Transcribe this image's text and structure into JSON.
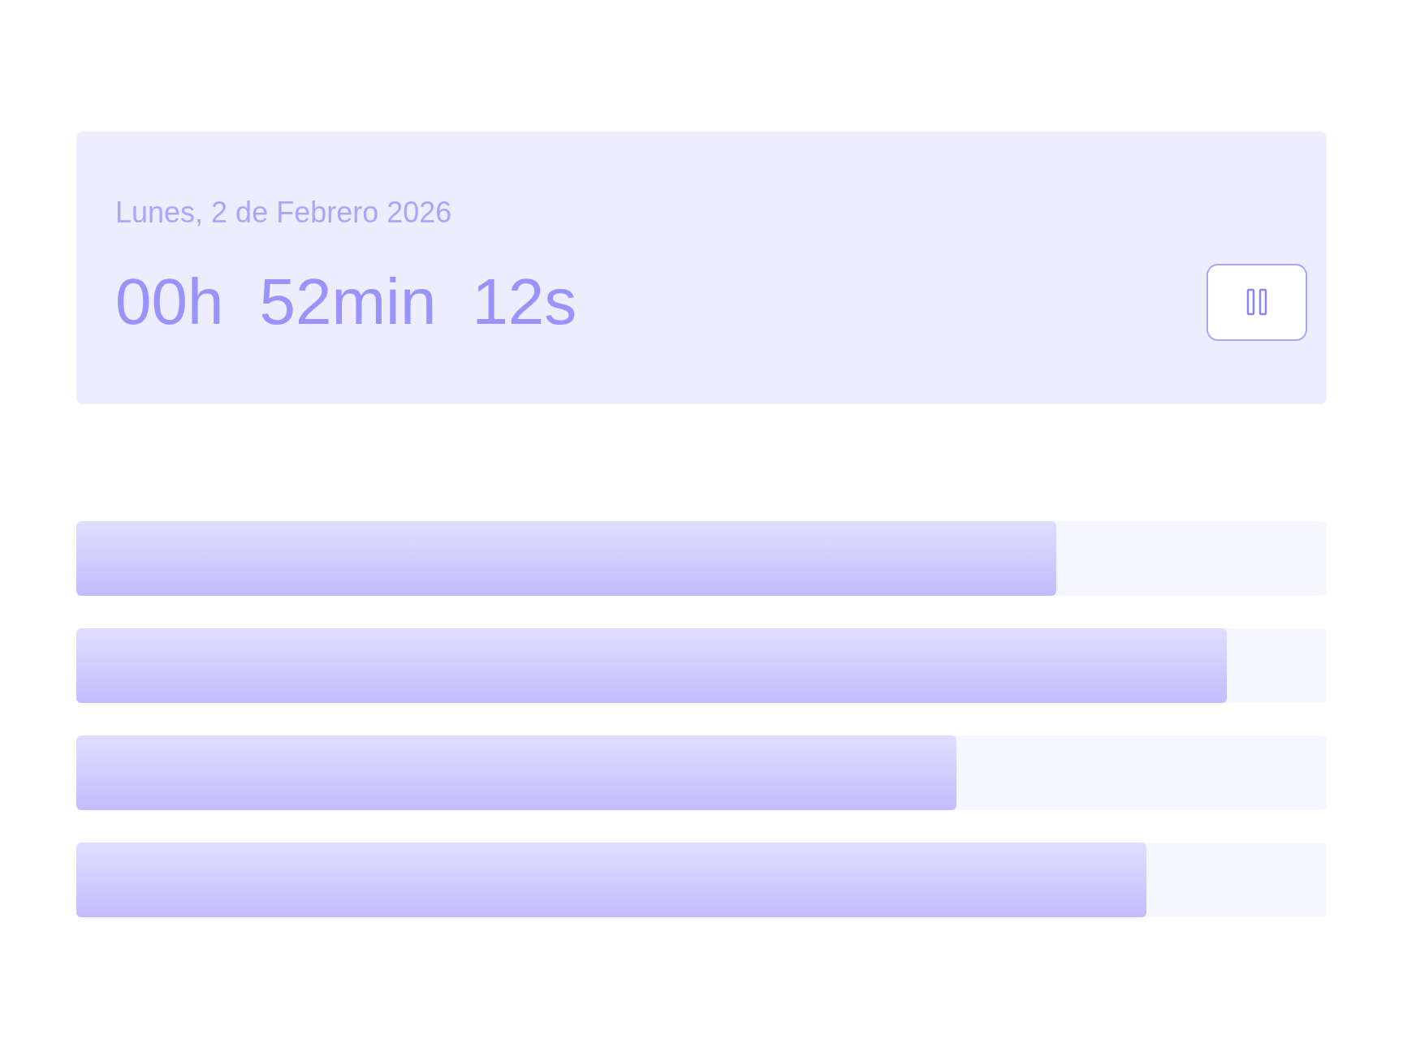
{
  "timer_card": {
    "date": "Lunes, 2 de Febrero 2026",
    "time_parts": [
      "00h",
      "52min",
      "12s"
    ]
  },
  "bars": [
    {
      "level": 0.784
    },
    {
      "level": 0.92
    },
    {
      "level": 0.704
    },
    {
      "level": 0.856
    }
  ]
}
